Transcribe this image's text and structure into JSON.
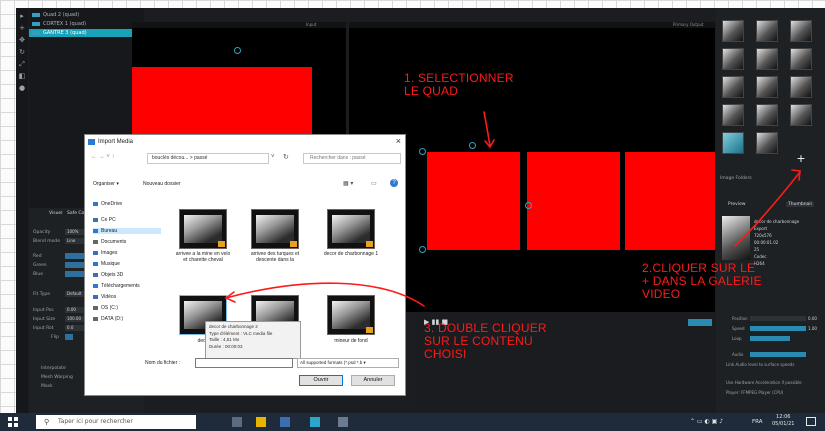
{
  "layers": {
    "items": [
      {
        "label": "Quad 2 (quad)",
        "selected": false
      },
      {
        "label": "CORTEX 1 (quad)",
        "selected": false
      },
      {
        "label": "GANTRE 3 (quad)",
        "selected": true
      }
    ]
  },
  "viewports": {
    "input_title": "Input",
    "output_title": "Primary Output"
  },
  "props": {
    "tabs": [
      "Visuel",
      "Safe Color"
    ],
    "rows": [
      {
        "label": "Opacity",
        "value": "100%"
      },
      {
        "label": "Blend mode",
        "value": "Line"
      },
      {
        "label": "Red",
        "value": ""
      },
      {
        "label": "Green",
        "value": ""
      },
      {
        "label": "Blue",
        "value": ""
      },
      {
        "label": "Fit Type",
        "value": "Default"
      },
      {
        "label": "Input Pos",
        "value": "0.00"
      },
      {
        "label": "Input Size",
        "value": "100.00"
      },
      {
        "label": "Input Rot",
        "value": "0.0"
      },
      {
        "label": "Flip",
        "value": ""
      }
    ],
    "checks": [
      "Interpolate",
      "Mesh Warping",
      "Mask"
    ]
  },
  "right_panel": {
    "image_folders": "Image Folders",
    "preview": "Preview",
    "thumbnail_mode": "Thumbnail",
    "info": [
      "decor de charbonnage",
      "Export",
      "720x576",
      "00:00:01.02",
      "25",
      "Codec",
      "H264"
    ],
    "controls": [
      {
        "label": "Position",
        "value": "0.00"
      },
      {
        "label": "Speed",
        "value": "1.00"
      },
      {
        "label": "Loop",
        "value": ""
      },
      {
        "label": "Audio",
        "value": ""
      }
    ],
    "link_option": "Link Audio level to surface speeds",
    "hw_accel": "Use Hardware Acceleration if possible",
    "player": "Player: FFMPEG Player (CPU)"
  },
  "dialog": {
    "title": "Import Media",
    "breadcrumb": "bouclés décou... > passé",
    "search_placeholder": "Rechercher dans : passé",
    "toolbar": {
      "organize": "Organiser ▾",
      "new_folder": "Nouveau dossier"
    },
    "nav": [
      {
        "label": "OneDrive",
        "color": "#2b79d0",
        "selected": false
      },
      {
        "label": "Ce PC",
        "color": "#3b6fb6",
        "selected": false
      },
      {
        "label": "Bureau",
        "color": "#2b79d0",
        "selected": true
      },
      {
        "label": "Documents",
        "color": "#666666",
        "selected": false
      },
      {
        "label": "Images",
        "color": "#3b6fb6",
        "selected": false
      },
      {
        "label": "Musique",
        "color": "#2b79d0",
        "selected": false
      },
      {
        "label": "Objets 3D",
        "color": "#3b6fb6",
        "selected": false
      },
      {
        "label": "Téléchargements",
        "color": "#2b79d0",
        "selected": false
      },
      {
        "label": "Vidéos",
        "color": "#3b6fb6",
        "selected": false
      },
      {
        "label": "OS (C:)",
        "color": "#666666",
        "selected": false
      },
      {
        "label": "DATA (D:)",
        "color": "#666666",
        "selected": false
      }
    ],
    "files": [
      {
        "name": "arrivee a la mine en velo et charette cheval"
      },
      {
        "name": "arrivee des turques et descente dans la"
      },
      {
        "name": "decor de charbonnage 1"
      },
      {
        "name": "deco"
      },
      {
        "name": ""
      },
      {
        "name": "mineur de fond"
      }
    ],
    "tooltip": [
      "decor de charbonnage 2",
      "Type d'élément : VLC media file",
      "Taille : 4,51 Mo",
      "Durée : 00:00:03"
    ],
    "filename_label": "Nom du fichier :",
    "filetype": "All supported formats (*.psd *.b ▾",
    "open_label": "Ouvrir",
    "cancel_label": "Annuler"
  },
  "annotations": {
    "step1": [
      "1. SELECTIONNER",
      "LE QUAD"
    ],
    "step2": [
      "2.CLIQUER SUR LE",
      "+ DANS LA GALERIE",
      "VIDEO"
    ],
    "step3": [
      "3. DOUBLE CLIQUER",
      "SUR LE CONTENU",
      "CHOISI"
    ],
    "color": "#ff1a1a"
  },
  "taskbar": {
    "search_placeholder": "Taper ici pour rechercher",
    "lang": "FRA",
    "time": "12:06",
    "date": "05/01/21"
  }
}
